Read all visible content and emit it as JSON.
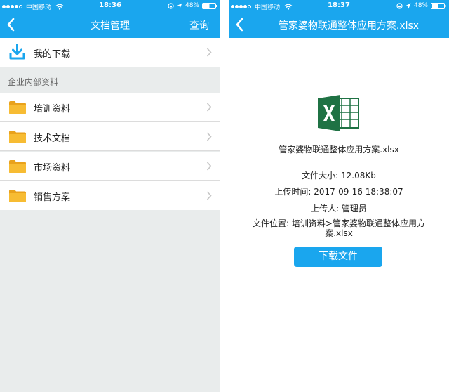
{
  "left": {
    "status": {
      "carrier": "中国移动",
      "time": "18:36",
      "battery": "48%"
    },
    "nav": {
      "title": "文档管理",
      "action": "查询",
      "back_icon": "back-arrow-icon"
    },
    "download_row": {
      "label": "我的下载",
      "icon": "download-icon"
    },
    "section_header": "企业内部资料",
    "folders": [
      {
        "label": "培训资料",
        "icon": "folder-icon"
      },
      {
        "label": "技术文档",
        "icon": "folder-icon"
      },
      {
        "label": "市场资料",
        "icon": "folder-icon"
      },
      {
        "label": "销售方案",
        "icon": "folder-icon"
      }
    ]
  },
  "right": {
    "status": {
      "carrier": "中国移动",
      "time": "18:37",
      "battery": "48%"
    },
    "nav": {
      "title": "管家婆物联通整体应用方案.xlsx",
      "back_icon": "back-arrow-icon"
    },
    "file": {
      "icon": "excel-icon",
      "name": "管家婆物联通整体应用方案.xlsx",
      "size": "文件大小: 12.08Kb",
      "upload_time": "上传时间: 2017-09-16 18:38:07",
      "uploader": "上传人: 管理员",
      "location_line1": "文件位置: 培训资料>管家婆物联通整体应用方",
      "location_line2": "案.xlsx"
    },
    "download_button": "下载文件"
  },
  "colors": {
    "accent": "#1aa6ee",
    "background": "#e9ecec",
    "folder": "#f5b82e",
    "excel": "#1f7244"
  }
}
